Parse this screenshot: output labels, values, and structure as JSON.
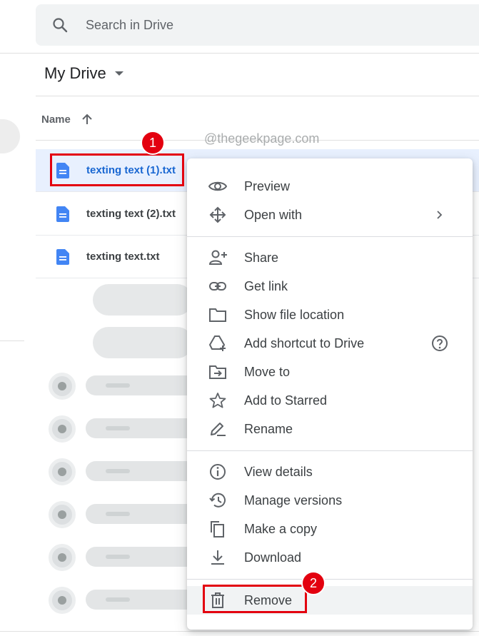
{
  "search": {
    "placeholder": "Search in Drive"
  },
  "breadcrumb": {
    "title": "My Drive"
  },
  "file_list": {
    "column_header": "Name",
    "files": [
      {
        "name": "texting text (1).txt",
        "selected": true
      },
      {
        "name": "texting text (2).txt",
        "selected": false
      },
      {
        "name": "texting text.txt",
        "selected": false
      }
    ]
  },
  "watermark": "@thegeekpage.com",
  "annotations": {
    "step1": "1",
    "step2": "2"
  },
  "context_menu": {
    "groups": [
      [
        {
          "label": "Preview",
          "icon": "eye-icon"
        },
        {
          "label": "Open with",
          "icon": "move-arrows-icon",
          "submenu": true
        }
      ],
      [
        {
          "label": "Share",
          "icon": "person-add-icon"
        },
        {
          "label": "Get link",
          "icon": "link-icon"
        },
        {
          "label": "Show file location",
          "icon": "folder-icon"
        },
        {
          "label": "Add shortcut to Drive",
          "icon": "drive-shortcut-icon",
          "help": true
        },
        {
          "label": "Move to",
          "icon": "folder-move-icon"
        },
        {
          "label": "Add to Starred",
          "icon": "star-icon"
        },
        {
          "label": "Rename",
          "icon": "pencil-icon"
        }
      ],
      [
        {
          "label": "View details",
          "icon": "info-icon"
        },
        {
          "label": "Manage versions",
          "icon": "history-icon"
        },
        {
          "label": "Make a copy",
          "icon": "copy-icon"
        },
        {
          "label": "Download",
          "icon": "download-icon"
        }
      ],
      [
        {
          "label": "Remove",
          "icon": "trash-icon",
          "highlighted": true
        }
      ]
    ]
  },
  "colors": {
    "accent_blue": "#1967d2",
    "doc_blue": "#4285f4",
    "annotation_red": "#e3000f",
    "selection_bg": "#e8f0fe"
  }
}
